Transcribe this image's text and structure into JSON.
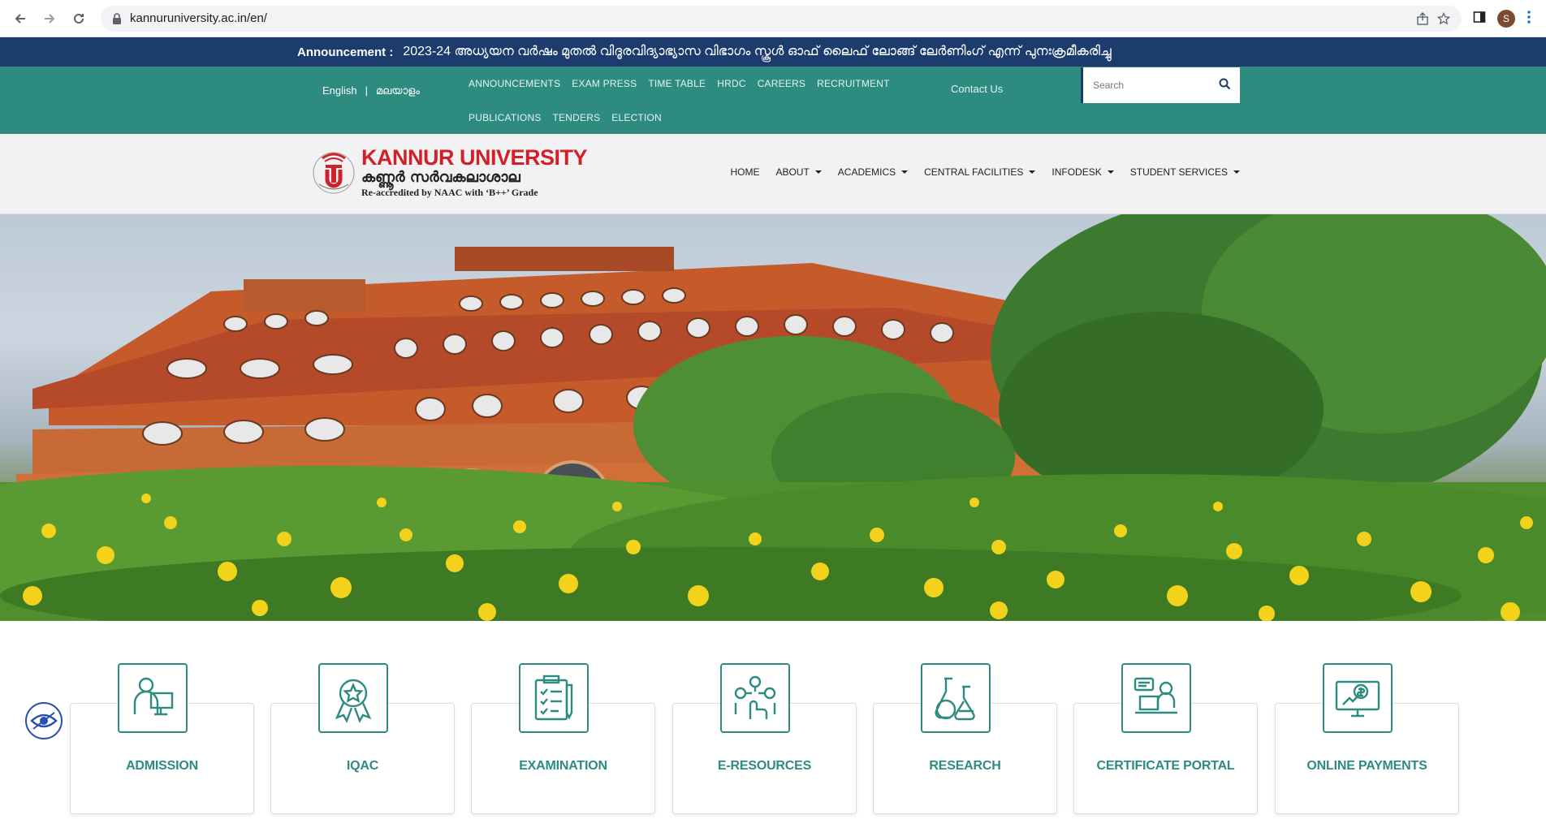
{
  "browser": {
    "url": "kannuruniversity.ac.in/en/",
    "profile_initial": "S"
  },
  "announcement": {
    "label": "Announcement :",
    "text": "2023-24 അധ്യയന വർഷം മുതൽ വിദൂരവിദ്യാഭ്യാസ വിഭാഗം സ്കൂൾ ഓഫ് ലൈഫ് ലോങ്ങ് ലേർണിംഗ് എന്ന് പുനഃക്രമീകരിച്ചു"
  },
  "utility": {
    "lang_english": "English",
    "lang_sep": "|",
    "lang_malayalam": "മലയാളം",
    "links": [
      "ANNOUNCEMENTS",
      "EXAM PRESS",
      "TIME TABLE",
      "HRDC",
      "CAREERS",
      "RECRUITMENT",
      "PUBLICATIONS",
      "TENDERS",
      "ELECTION"
    ],
    "contact": "Contact Us",
    "search_placeholder": "Search"
  },
  "header": {
    "logo_title": "KANNUR UNIVERSITY",
    "logo_malayalam": "കണ്ണൂർ സർവകലാശാല",
    "logo_sub": "Re-accredited by NAAC with ‘B++’ Grade",
    "nav": [
      "HOME",
      "ABOUT",
      "ACADEMICS",
      "CENTRAL FACILITIES",
      "INFODESK",
      "STUDENT SERVICES"
    ]
  },
  "quick_links": [
    {
      "label": "ADMISSION",
      "icon": "admission-icon"
    },
    {
      "label": "IQAC",
      "icon": "award-icon"
    },
    {
      "label": "EXAMINATION",
      "icon": "clipboard-checklist-icon"
    },
    {
      "label": "E-RESOURCES",
      "icon": "network-touch-icon"
    },
    {
      "label": "RESEARCH",
      "icon": "flask-icon"
    },
    {
      "label": "CERTIFICATE PORTAL",
      "icon": "certificate-desk-icon"
    },
    {
      "label": "ONLINE PAYMENTS",
      "icon": "online-payment-icon"
    }
  ],
  "colors": {
    "announcement_bg": "#1d3c6e",
    "teal": "#2d8b80",
    "logo_red": "#d0202a"
  }
}
